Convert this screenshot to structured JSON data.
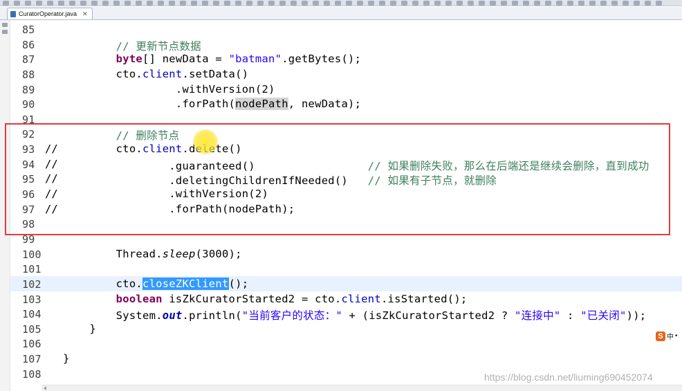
{
  "editor_tab": {
    "title": "CuratorOperator.java",
    "close_glyph": "✕"
  },
  "code_lines": [
    {
      "n": "85",
      "comment_prefix": "",
      "html": ""
    },
    {
      "n": "86",
      "comment_prefix": "",
      "html": "        <span class=\"cm\">// 更新节点数据</span>"
    },
    {
      "n": "87",
      "comment_prefix": "",
      "html": "        <span class=\"kw\">byte</span>[] newData = <span class=\"str\">\"batman\"</span>.getBytes();"
    },
    {
      "n": "88",
      "comment_prefix": "",
      "html": "        cto.<span class=\"fld\">client</span>.setData()"
    },
    {
      "n": "89",
      "comment_prefix": "",
      "html": "                 .withVersion(2)"
    },
    {
      "n": "90",
      "comment_prefix": "",
      "html": "                 .forPath(<span class=\"mark\">nodePath</span>, newData);"
    },
    {
      "n": "91",
      "comment_prefix": "",
      "html": ""
    },
    {
      "n": "92",
      "comment_prefix": "",
      "html": "        <span class=\"cm\">// 删除节点</span>"
    },
    {
      "n": "93",
      "comment_prefix": "//",
      "html": "        cto.<span class=\"fld\">client</span>.delete()"
    },
    {
      "n": "94",
      "comment_prefix": "//",
      "html": "                .guaranteed()                 <span class=\"cm\">// 如果删除失败，那么在后端还是继续会删除，直到成功</span>"
    },
    {
      "n": "95",
      "comment_prefix": "//",
      "html": "                .deletingChildrenIfNeeded()   <span class=\"cm\">// 如果有子节点，就删除</span>"
    },
    {
      "n": "96",
      "comment_prefix": "//",
      "html": "                .withVersion(2)"
    },
    {
      "n": "97",
      "comment_prefix": "//",
      "html": "                .forPath(nodePath);"
    },
    {
      "n": "98",
      "comment_prefix": "",
      "html": ""
    },
    {
      "n": "99",
      "comment_prefix": "",
      "html": ""
    },
    {
      "n": "100",
      "comment_prefix": "",
      "html": "        Thread.<span class=\"it\">sleep</span>(3000);"
    },
    {
      "n": "101",
      "comment_prefix": "",
      "html": ""
    },
    {
      "n": "102",
      "comment_prefix": "",
      "html": "        cto.<span class=\"sel\">closeZKClient</span>();",
      "current": true
    },
    {
      "n": "103",
      "comment_prefix": "",
      "html": "        <span class=\"kw\">boolean</span> isZkCuratorStarted2 = cto.<span class=\"fld\">client</span>.isStarted();"
    },
    {
      "n": "104",
      "comment_prefix": "",
      "html": "        System.<span class=\"sfld\">out</span>.println(<span class=\"str\">\"当前客户的状态：\"</span> + (isZkCuratorStarted2 ? <span class=\"str\">\"连接中\"</span> : <span class=\"str\">\"已关闭\"</span>));"
    },
    {
      "n": "105",
      "comment_prefix": "",
      "html": "    }"
    },
    {
      "n": "106",
      "comment_prefix": "",
      "html": ""
    },
    {
      "n": "107",
      "comment_prefix": "",
      "html": "}"
    },
    {
      "n": "108",
      "comment_prefix": "",
      "html": ""
    }
  ],
  "ime_indicator": {
    "logo": "S",
    "mode": "中",
    "extra": "•"
  },
  "watermark": "https://blog.csdn.net/liuming690452074",
  "colors": {
    "keyword": "#7f0055",
    "comment": "#3f7f5f",
    "string": "#2a00ff",
    "field": "#0000c0",
    "selection": "#3399ff",
    "current_line": "#e8f2fe",
    "annotation_box": "#e53a3a",
    "cursor_highlight": "#ffe028"
  }
}
